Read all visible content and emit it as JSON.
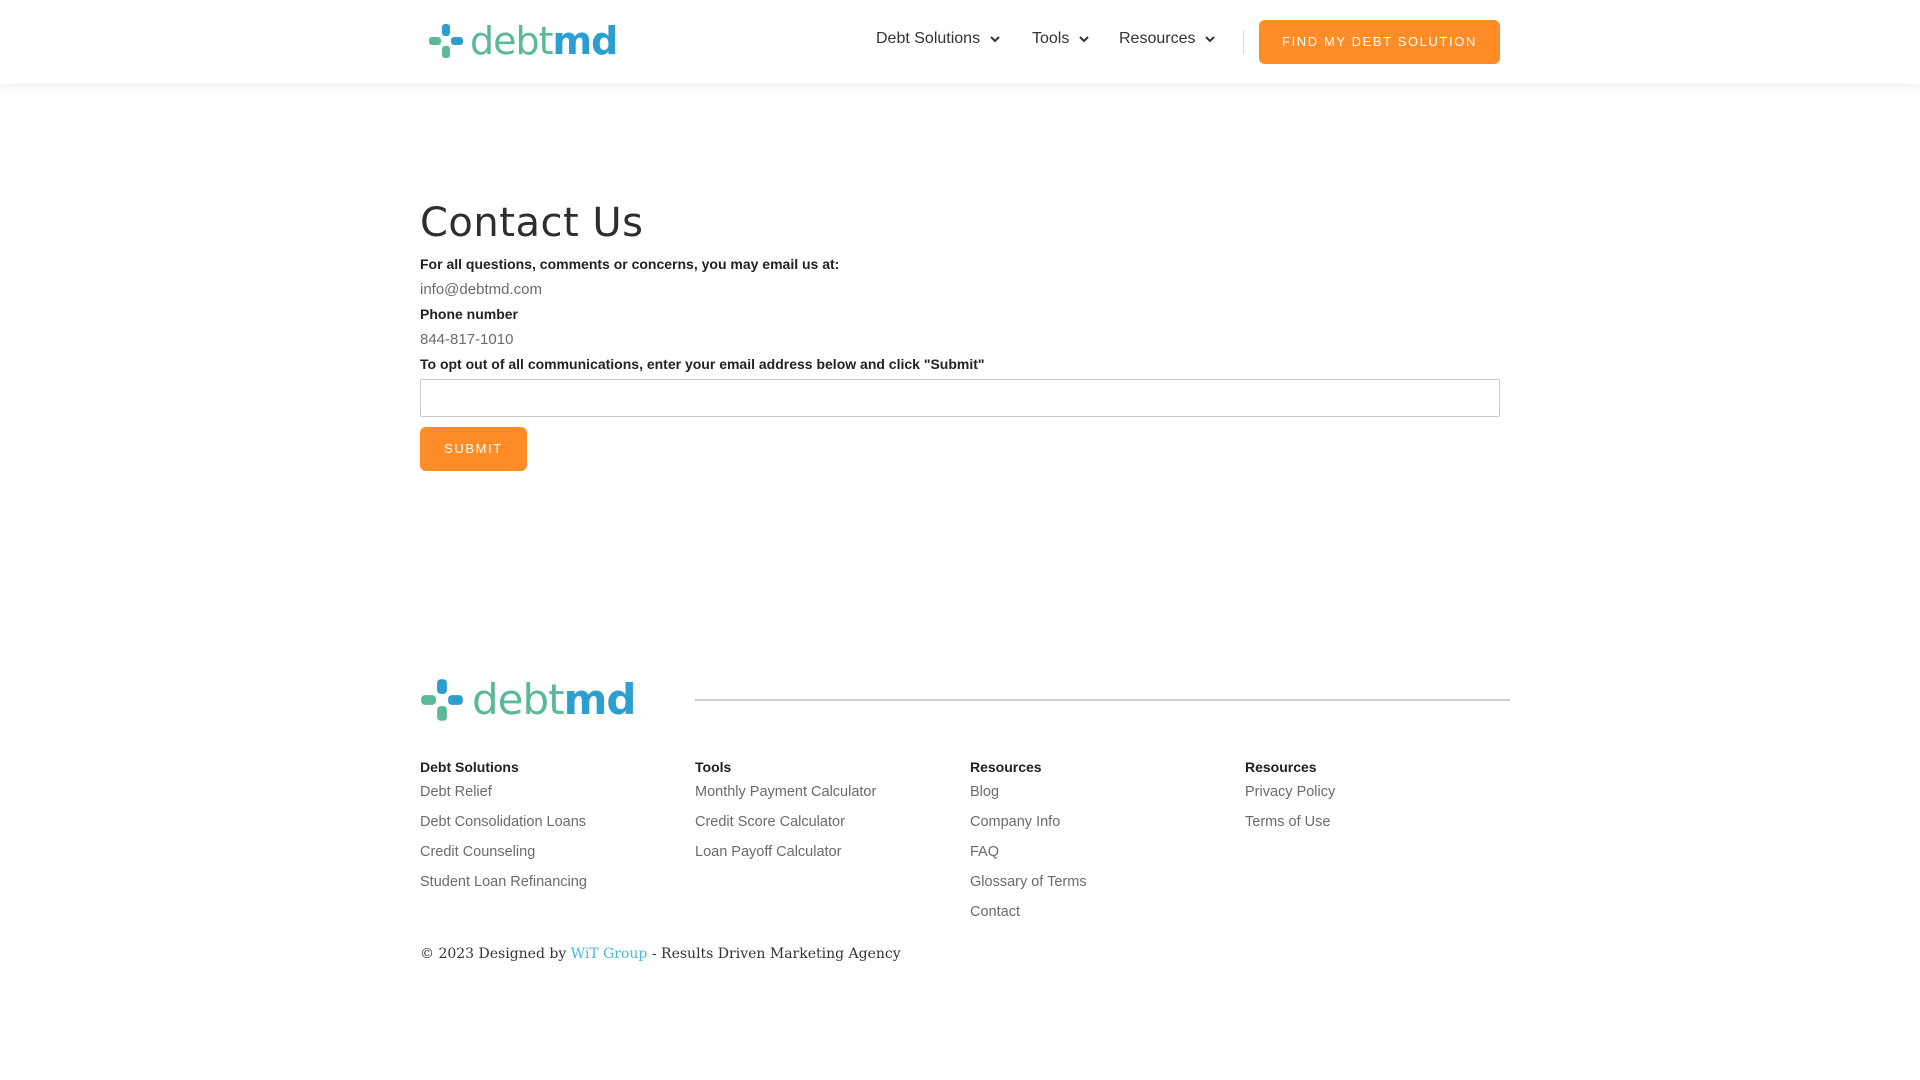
{
  "header": {
    "logo": {
      "word_part1": "debt",
      "word_part2": "md"
    },
    "nav": [
      {
        "label": "Debt Solutions",
        "has_dropdown": true
      },
      {
        "label": "Tools",
        "has_dropdown": true
      },
      {
        "label": "Resources",
        "has_dropdown": true
      }
    ],
    "cta_label": "FIND MY DEBT SOLUTION"
  },
  "main": {
    "title": "Contact Us",
    "email_prompt": "For all questions, comments or concerns, you may email us at:",
    "email": "info@debtmd.com",
    "phone_label": "Phone number",
    "phone": "844-817-1010",
    "optout_prompt": "To opt out of all communications, enter your email address below and click \"Submit\"",
    "optout_input_value": "",
    "submit_label": "SUBMIT"
  },
  "footer": {
    "logo": {
      "word_part1": "debt",
      "word_part2": "md"
    },
    "columns": [
      {
        "heading": "Debt Solutions",
        "links": [
          "Debt Relief",
          "Debt Consolidation Loans",
          "Credit Counseling",
          "Student Loan Refinancing"
        ]
      },
      {
        "heading": "Tools",
        "links": [
          "Monthly Payment Calculator",
          "Credit Score Calculator",
          "Loan Payoff Calculator"
        ]
      },
      {
        "heading": "Resources",
        "links": [
          "Blog",
          "Company Info",
          "FAQ",
          "Glossary of Terms",
          "Contact"
        ]
      },
      {
        "heading": "Resources",
        "links": [
          "Privacy Policy",
          "Terms of Use"
        ]
      }
    ],
    "copyright_prefix": "© 2023 Designed by",
    "copyright_link": "WiT Group",
    "copyright_suffix": " - Results Driven Marketing Agency"
  },
  "colors": {
    "accent_orange": "#ff8c26",
    "logo_green": "#5bb99a",
    "logo_blue": "#2c9fd0",
    "link_blue": "#4bb8d8"
  },
  "icons": {
    "logo_mark": "plus-cross-logo-icon",
    "dropdown": "chevron-down-icon"
  }
}
